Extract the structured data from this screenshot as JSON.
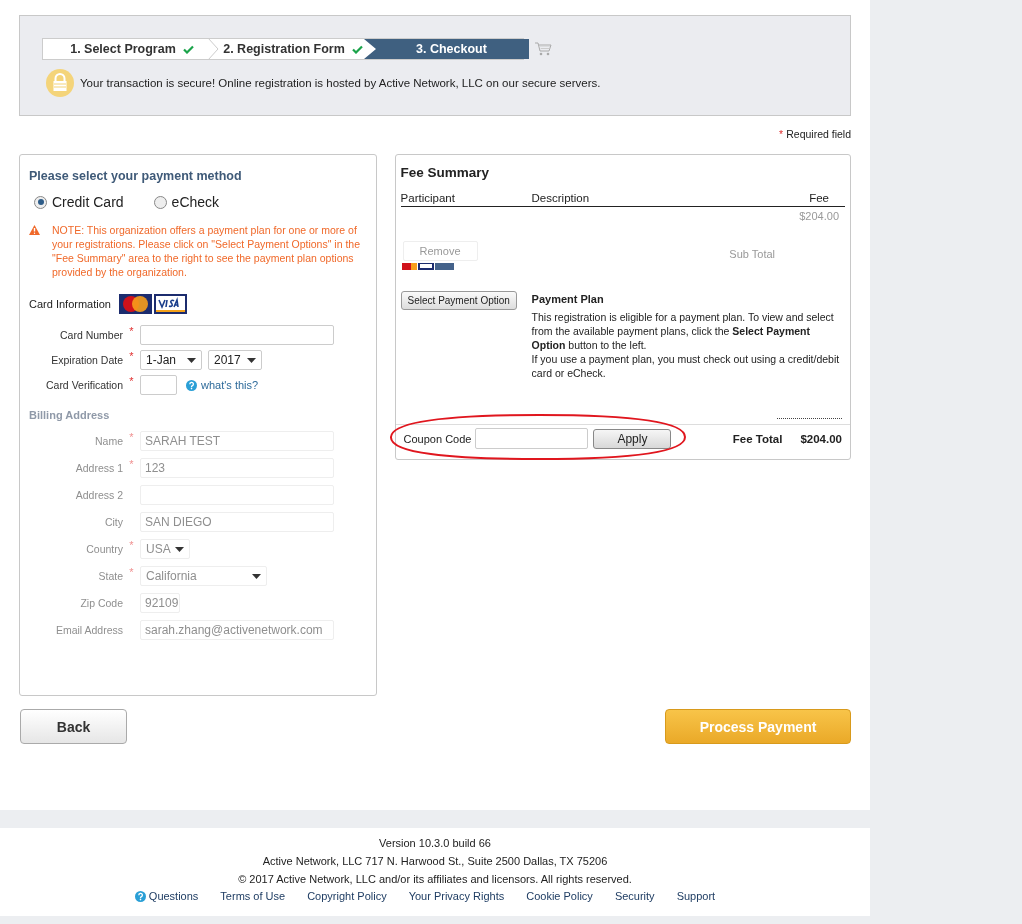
{
  "steps": [
    {
      "label": "1. Select Program",
      "done": true,
      "selected": false
    },
    {
      "label": "2. Registration Form",
      "done": true,
      "selected": false
    },
    {
      "label": "3. Checkout",
      "done": false,
      "selected": true
    }
  ],
  "secure_notice": "Your transaction is secure! Online registration is hosted by Active Network, LLC on our secure servers.",
  "required_note": {
    "mark": "*",
    "text": "Required field"
  },
  "payment_method": {
    "title": "Please select your payment method",
    "options": [
      {
        "label": "Credit Card",
        "selected": true
      },
      {
        "label": "eCheck",
        "selected": false
      }
    ],
    "note": "NOTE: This organization offers a payment plan for one or more of your registrations. Please click on \"Select Payment Options\" in the \"Fee Summary\" area to the right to see the payment plan options provided by the organization.",
    "card_information": "Card Information",
    "fields": [
      {
        "kind": "input",
        "label": "Card Number",
        "required": true
      },
      {
        "kind": "selects",
        "label": "Expiration Date",
        "required": true,
        "values": [
          "1-Jan",
          "2017"
        ]
      },
      {
        "kind": "cvv",
        "label": "Card Verification",
        "required": true,
        "help": "what's this?"
      }
    ]
  },
  "billing": {
    "title": "Billing Address",
    "fields": [
      {
        "kind": "input",
        "label": "Name",
        "required": true,
        "value": "SARAH TEST"
      },
      {
        "kind": "input",
        "label": "Address 1",
        "required": true,
        "value": "123"
      },
      {
        "kind": "input",
        "label": "Address 2",
        "required": false
      },
      {
        "kind": "input",
        "label": "City",
        "required": false,
        "value": "SAN DIEGO"
      },
      {
        "kind": "select",
        "label": "Country",
        "required": true,
        "value": "USA"
      },
      {
        "kind": "select",
        "label": "State",
        "required": true,
        "value": "California"
      },
      {
        "kind": "short",
        "label": "Zip Code",
        "required": false,
        "value": "92109"
      },
      {
        "kind": "input",
        "label": "Email Address",
        "required": false,
        "value": "sarah.zhang@activenetwork.com"
      }
    ]
  },
  "fee_summary": {
    "title": "Fee Summary",
    "columns": [
      "Participant",
      "Description",
      "Fee"
    ],
    "faded_row": {
      "fee": "$204.00",
      "remove": "Remove",
      "sub_total": "Sub Total"
    },
    "select_button": "Select Payment Option",
    "plan_title": "Payment Plan",
    "plan_text": [
      "This registration is eligible for a payment plan. To view and select from the available payment plans, click the **Select Payment Option** button to the left.",
      "If you use a payment plan, you must check out using a credit/debit card or eCheck."
    ],
    "coupon": {
      "label": "Coupon Code",
      "button": "Apply"
    },
    "fee_total": {
      "label": "Fee Total",
      "value": "$204.00"
    }
  },
  "actions": {
    "back": "Back",
    "process": "Process Payment"
  },
  "footer": {
    "lines": [
      "Version 10.3.0 build 66",
      "Active Network, LLC 717 N. Harwood St., Suite 2500 Dallas, TX 75206",
      "© 2017 Active Network, LLC and/or its affiliates and licensors. All rights reserved."
    ],
    "links": [
      {
        "label": "Questions",
        "kind": "help"
      },
      {
        "label": "Terms of Use",
        "kind": "plain"
      },
      {
        "label": "Copyright Policy",
        "kind": "plain"
      },
      {
        "label": "Your Privacy Rights",
        "kind": "plain"
      },
      {
        "label": "Cookie Policy",
        "kind": "plain"
      },
      {
        "label": "Security",
        "kind": "plain"
      },
      {
        "label": "Support",
        "kind": "plain"
      }
    ]
  }
}
